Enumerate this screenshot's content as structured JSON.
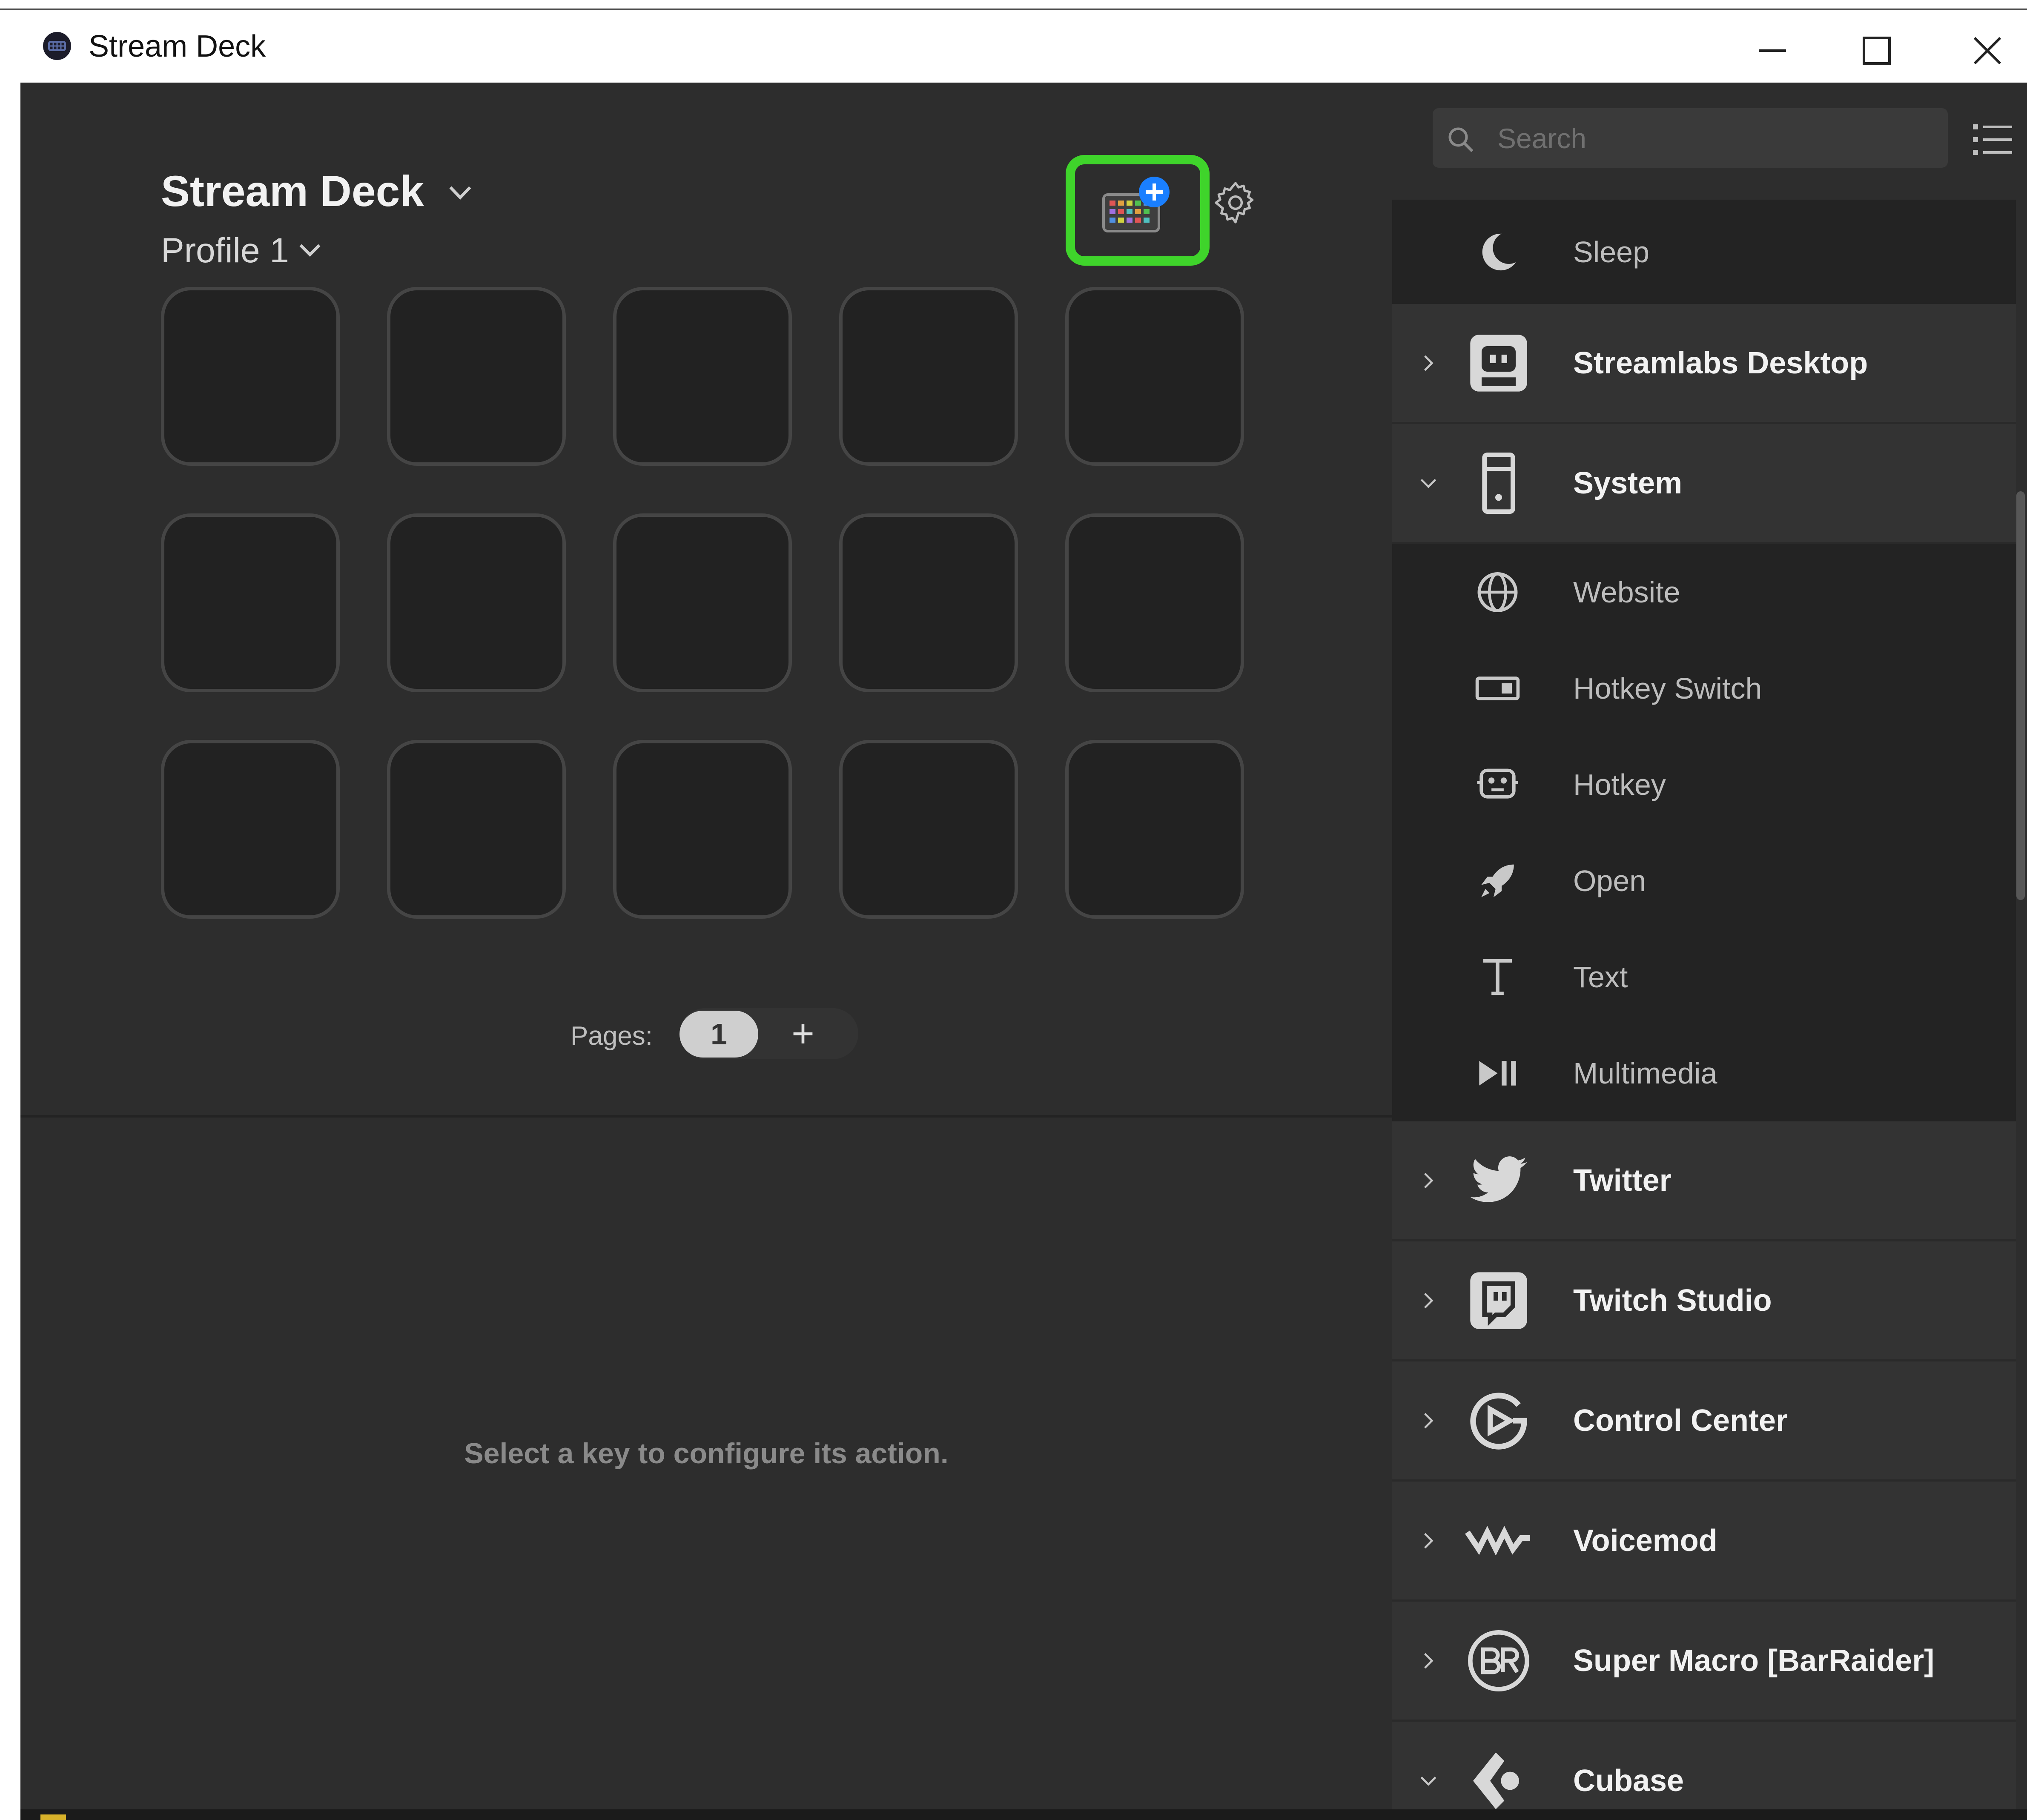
{
  "window": {
    "title": "Stream Deck"
  },
  "device": {
    "name": "Stream Deck",
    "profile": "Profile 1"
  },
  "keys": {
    "count": 15,
    "columns": 5,
    "rows": 3
  },
  "pages": {
    "label": "Pages:",
    "current": "1",
    "add_label": "+"
  },
  "config_panel": {
    "message": "Select a key to configure its action."
  },
  "search": {
    "placeholder": "Search",
    "value": ""
  },
  "actions": [
    {
      "label": "Sleep",
      "kind": "action",
      "icon": "moon-icon"
    },
    {
      "label": "Streamlabs Desktop",
      "kind": "category",
      "expanded": false,
      "icon": "streamlabs-obs-icon"
    },
    {
      "label": "System",
      "kind": "category",
      "expanded": true,
      "icon": "computer-tower-icon"
    },
    {
      "label": "Website",
      "kind": "action",
      "icon": "globe-icon"
    },
    {
      "label": "Hotkey Switch",
      "kind": "action",
      "icon": "hotkey-switch-icon"
    },
    {
      "label": "Hotkey",
      "kind": "action",
      "icon": "hotkey-robot-icon"
    },
    {
      "label": "Open",
      "kind": "action",
      "icon": "rocket-icon"
    },
    {
      "label": "Text",
      "kind": "action",
      "icon": "text-t-icon"
    },
    {
      "label": "Multimedia",
      "kind": "action",
      "icon": "play-pause-icon"
    },
    {
      "label": "Twitter",
      "kind": "category",
      "expanded": false,
      "icon": "twitter-bird-icon"
    },
    {
      "label": "Twitch Studio",
      "kind": "category",
      "expanded": false,
      "icon": "twitch-studio-icon"
    },
    {
      "label": "Control Center",
      "kind": "category",
      "expanded": false,
      "icon": "control-center-icon"
    },
    {
      "label": "Voicemod",
      "kind": "category",
      "expanded": false,
      "icon": "voicemod-icon"
    },
    {
      "label": "Super Macro [BarRaider]",
      "kind": "category",
      "expanded": false,
      "icon": "barraider-icon"
    },
    {
      "label": "Cubase",
      "kind": "category",
      "expanded": true,
      "icon": "cubase-icon"
    }
  ],
  "colors": {
    "highlight": "#3fd42b",
    "background": "#2d2d2d",
    "key_face": "#222222",
    "badge_blue": "#1a7fff"
  }
}
